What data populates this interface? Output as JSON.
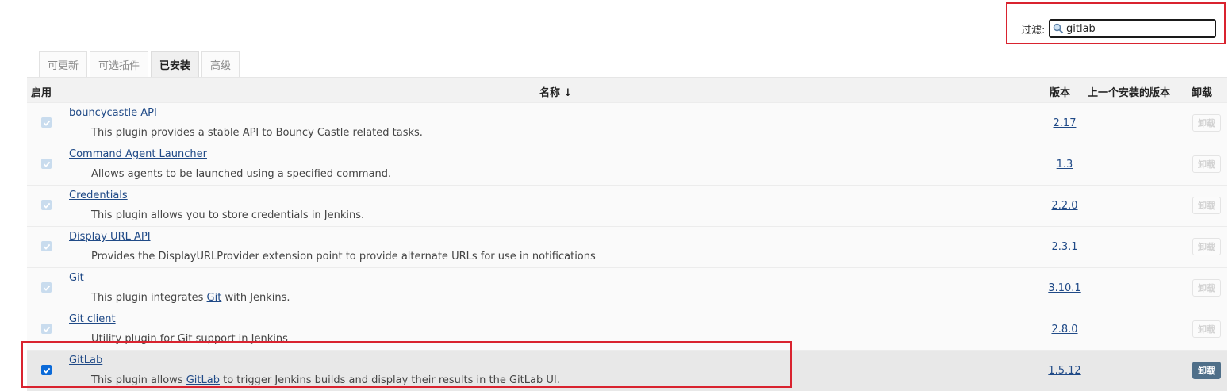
{
  "filter": {
    "label": "过滤:",
    "value": "gitlab"
  },
  "tabs": [
    "可更新",
    "可选插件",
    "已安装",
    "高级"
  ],
  "active_tab": "已安装",
  "columns": {
    "enabled": "启用",
    "name": "名称 ↓",
    "version": "版本",
    "previous_version": "上一个安装的版本",
    "uninstall": "卸载"
  },
  "plugins": [
    {
      "name": "bouncycastle API",
      "desc_before": "This plugin provides a stable API to Bouncy Castle related tasks.",
      "desc_link": "",
      "desc_after": "",
      "version": "2.17",
      "enabled": true,
      "uninstall": "卸载",
      "uninstall_enabled": false
    },
    {
      "name": "Command Agent Launcher",
      "desc_before": "Allows agents to be launched using a specified command.",
      "desc_link": "",
      "desc_after": "",
      "version": "1.3",
      "enabled": true,
      "uninstall": "卸载",
      "uninstall_enabled": false
    },
    {
      "name": "Credentials",
      "desc_before": "This plugin allows you to store credentials in Jenkins.",
      "desc_link": "",
      "desc_after": "",
      "version": "2.2.0",
      "enabled": true,
      "uninstall": "卸载",
      "uninstall_enabled": false
    },
    {
      "name": "Display URL API",
      "desc_before": "Provides the DisplayURLProvider extension point to provide alternate URLs for use in notifications",
      "desc_link": "",
      "desc_after": "",
      "version": "2.3.1",
      "enabled": true,
      "uninstall": "卸载",
      "uninstall_enabled": false
    },
    {
      "name": "Git",
      "desc_before": "This plugin integrates ",
      "desc_link": "Git",
      "desc_after": " with Jenkins.",
      "version": "3.10.1",
      "enabled": true,
      "uninstall": "卸载",
      "uninstall_enabled": false
    },
    {
      "name": "Git client",
      "desc_before": "Utility plugin for Git support in Jenkins",
      "desc_link": "",
      "desc_after": "",
      "version": "2.8.0",
      "enabled": true,
      "uninstall": "卸载",
      "uninstall_enabled": false
    },
    {
      "name": "GitLab",
      "desc_before": "This plugin allows ",
      "desc_link": "GitLab",
      "desc_after": " to trigger Jenkins builds and display their results in the GitLab UI.",
      "version": "1.5.12",
      "enabled": true,
      "uninstall": "卸载",
      "uninstall_enabled": true
    }
  ],
  "colors": {
    "highlight_border": "#d9232f",
    "link": "#204a87",
    "checkbox_active": "#0b6ad8",
    "uninstall_active": "#4f6f89"
  }
}
